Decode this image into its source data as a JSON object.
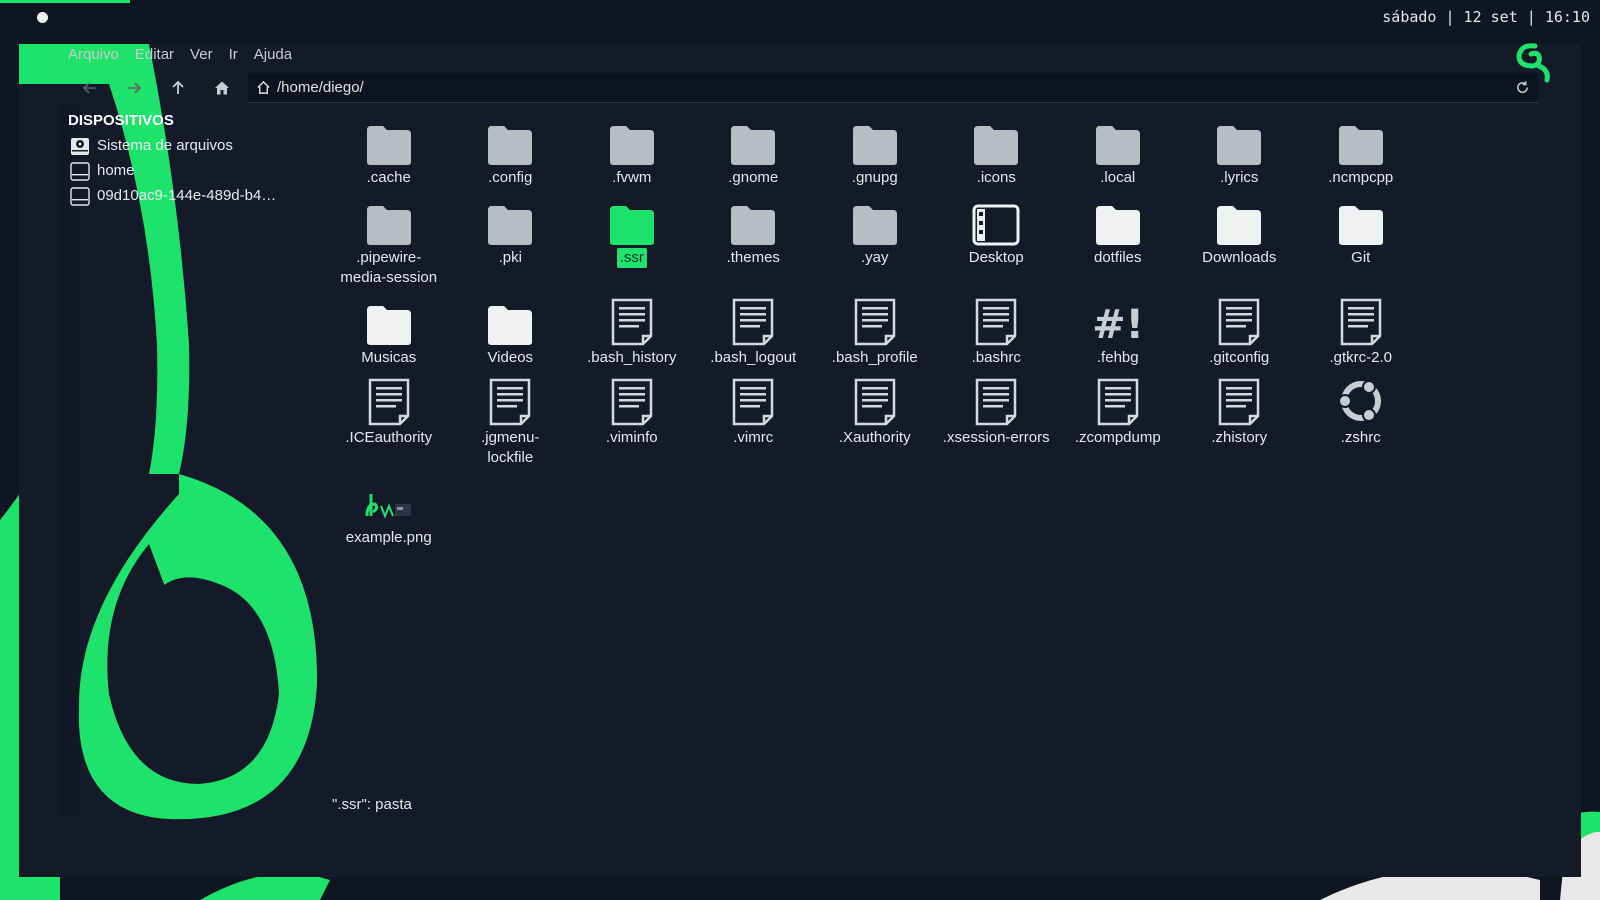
{
  "topbar": {
    "clock": "sábado | 12 set | 16:10"
  },
  "colors": {
    "accent": "#1ee36a",
    "background": "#141a2a",
    "folder": "#b9bcc2"
  },
  "menu": [
    "Arquivo",
    "Editar",
    "Ver",
    "Ir",
    "Ajuda"
  ],
  "toolbar": {
    "path": "/home/diego/",
    "back_icon": "arrow-left-icon",
    "forward_icon": "arrow-right-icon",
    "up_icon": "arrow-up-icon",
    "home_icon": "home-icon",
    "reload_icon": "reload-icon"
  },
  "sidebar": {
    "section": "DISPOSITIVOS",
    "items": [
      {
        "label": "Sistema de arquivos",
        "icon": "drive-root-icon"
      },
      {
        "label": "home",
        "icon": "drive-icon"
      },
      {
        "label": "09d10ac9-144e-489d-b4…",
        "icon": "drive-icon"
      }
    ]
  },
  "files": [
    [
      {
        "name": ".cache",
        "icon": "folder-hidden-icon"
      },
      {
        "name": ".config",
        "icon": "folder-hidden-icon"
      },
      {
        "name": ".fvwm",
        "icon": "folder-hidden-icon"
      },
      {
        "name": ".gnome",
        "icon": "folder-hidden-icon"
      },
      {
        "name": ".gnupg",
        "icon": "folder-hidden-icon"
      },
      {
        "name": ".icons",
        "icon": "folder-hidden-icon"
      },
      {
        "name": ".local",
        "icon": "folder-hidden-icon"
      },
      {
        "name": ".lyrics",
        "icon": "folder-hidden-icon"
      },
      {
        "name": ".ncmpcpp",
        "icon": "folder-hidden-icon"
      }
    ],
    [
      {
        "name": ".pipewire-media-session",
        "line1": ".pipewire-",
        "line2": "media-session",
        "icon": "folder-hidden-icon"
      },
      {
        "name": ".pki",
        "icon": "folder-hidden-icon"
      },
      {
        "name": ".ssr",
        "icon": "folder-selected-icon",
        "selected": true
      },
      {
        "name": ".themes",
        "icon": "folder-hidden-icon"
      },
      {
        "name": ".yay",
        "icon": "folder-hidden-icon"
      },
      {
        "name": "Desktop",
        "icon": "desktop-icon"
      },
      {
        "name": "dotfiles",
        "icon": "folder-icon"
      },
      {
        "name": "Downloads",
        "icon": "folder-icon"
      },
      {
        "name": "Git",
        "icon": "folder-icon"
      }
    ],
    [
      {
        "name": "Musicas",
        "icon": "folder-icon"
      },
      {
        "name": "Videos",
        "icon": "folder-icon"
      },
      {
        "name": ".bash_history",
        "icon": "text-file-icon"
      },
      {
        "name": ".bash_logout",
        "icon": "text-file-icon"
      },
      {
        "name": ".bash_profile",
        "icon": "text-file-icon"
      },
      {
        "name": ".bashrc",
        "icon": "text-file-icon"
      },
      {
        "name": ".fehbg",
        "icon": "script-icon"
      },
      {
        "name": ".gitconfig",
        "icon": "text-file-icon"
      },
      {
        "name": ".gtkrc-2.0",
        "icon": "text-file-icon"
      }
    ],
    [
      {
        "name": ".ICEauthority",
        "icon": "text-file-icon"
      },
      {
        "name": ".jgmenu-lockfile",
        "line1": ".jgmenu-",
        "line2": "lockfile",
        "icon": "text-file-icon"
      },
      {
        "name": ".viminfo",
        "icon": "text-file-icon"
      },
      {
        "name": ".vimrc",
        "icon": "text-file-icon"
      },
      {
        "name": ".Xauthority",
        "icon": "text-file-icon"
      },
      {
        "name": ".xsession-errors",
        "icon": "text-file-icon"
      },
      {
        "name": ".zcompdump",
        "icon": "text-file-icon"
      },
      {
        "name": ".zhistory",
        "icon": "text-file-icon"
      },
      {
        "name": ".zshrc",
        "icon": "ubuntu-logo-icon"
      }
    ],
    [
      {
        "name": "example.png",
        "icon": "image-thumbnail-icon"
      }
    ]
  ],
  "status": "\".ssr\": pasta"
}
